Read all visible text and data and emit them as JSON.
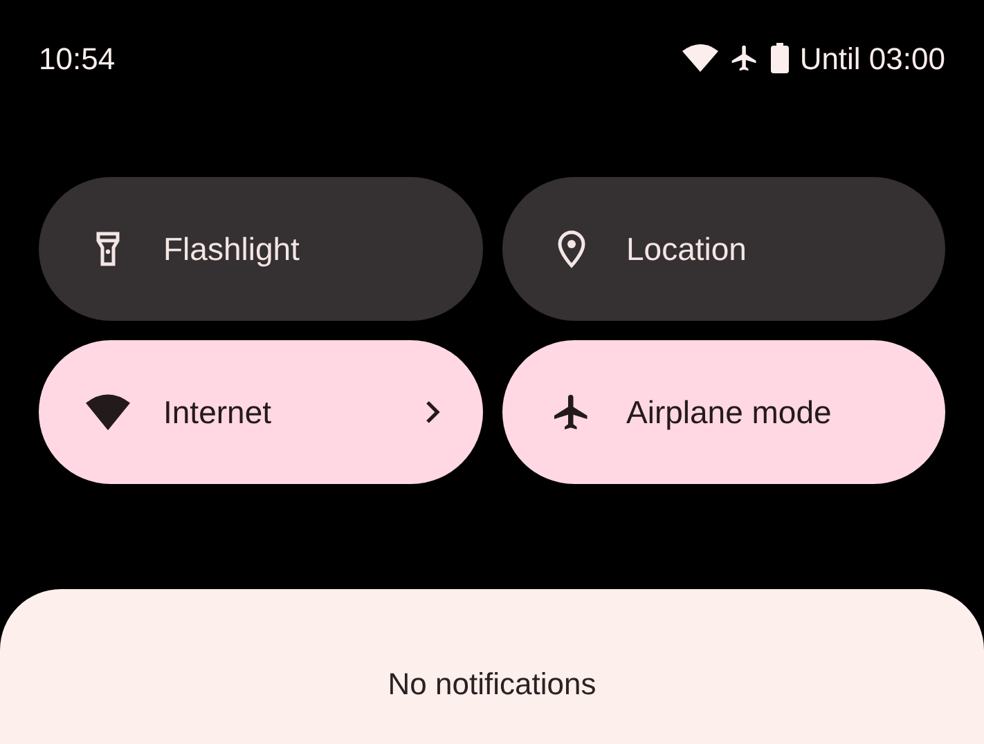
{
  "status_bar": {
    "time": "10:54",
    "battery_text": "Until 03:00"
  },
  "tiles": [
    {
      "kind": "flashlight",
      "label": "Flashlight",
      "on": false,
      "has_detail": false
    },
    {
      "kind": "location",
      "label": "Location",
      "on": false,
      "has_detail": false
    },
    {
      "kind": "internet",
      "label": "Internet",
      "on": true,
      "has_detail": true
    },
    {
      "kind": "airplane",
      "label": "Airplane mode",
      "on": true,
      "has_detail": false
    }
  ],
  "notifications": {
    "empty_text": "No notifications"
  }
}
